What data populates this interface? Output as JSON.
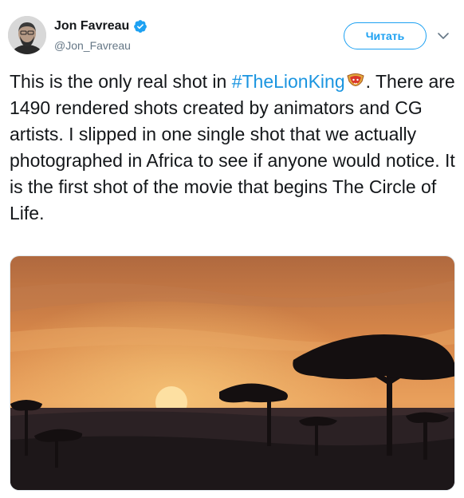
{
  "author": {
    "name": "Jon Favreau",
    "handle": "@Jon_Favreau",
    "verified": true
  },
  "header": {
    "follow_label": "Читать"
  },
  "tweet": {
    "text_before": "This is the only real shot in ",
    "hashtag": "#TheLionKing",
    "text_after": ". There are 1490 rendered shots created by animators and CG artists. I slipped in one single shot that we actually photographed in Africa to see if anyone would notice. It is the first shot of the movie that begins The Circle of Life.",
    "emoji": "lion-crown-emoji"
  },
  "media": {
    "type": "photo",
    "subject": "sunset-savanna-acacia-trees"
  },
  "colors": {
    "accent": "#1da1f2",
    "hashtag": "#1b95e0",
    "text": "#14171a",
    "muted": "#657786"
  }
}
